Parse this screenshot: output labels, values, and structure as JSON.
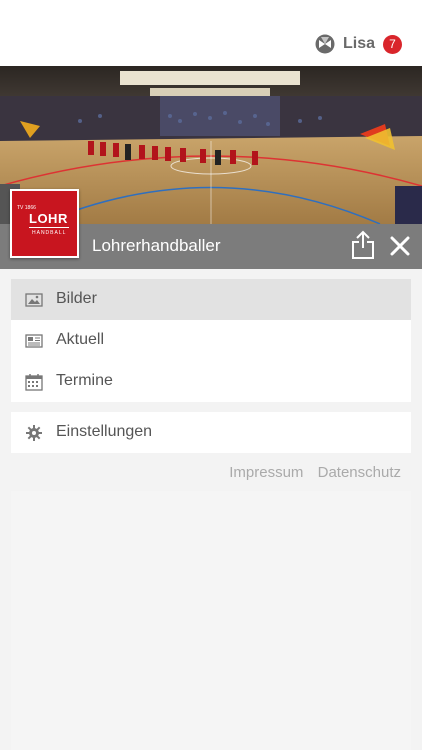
{
  "user": {
    "name": "Lisa",
    "notification_count": "7"
  },
  "club": {
    "name": "Lohrerhandballer",
    "logo_small_text": "TV 1866",
    "logo_main_text": "LOHR",
    "logo_sub_text": "HANDBALL"
  },
  "menu": {
    "items": [
      {
        "label": "Bilder",
        "icon": "image-icon",
        "active": true
      },
      {
        "label": "Aktuell",
        "icon": "newspaper-icon",
        "active": false
      },
      {
        "label": "Termine",
        "icon": "calendar-icon",
        "active": false
      }
    ],
    "settings": {
      "label": "Einstellungen",
      "icon": "gear-icon"
    }
  },
  "footer": {
    "impressum": "Impressum",
    "datenschutz": "Datenschutz"
  },
  "colors": {
    "accent_red": "#d9252b",
    "club_bar": "#7c7c7c",
    "logo_red": "#c8151f"
  }
}
